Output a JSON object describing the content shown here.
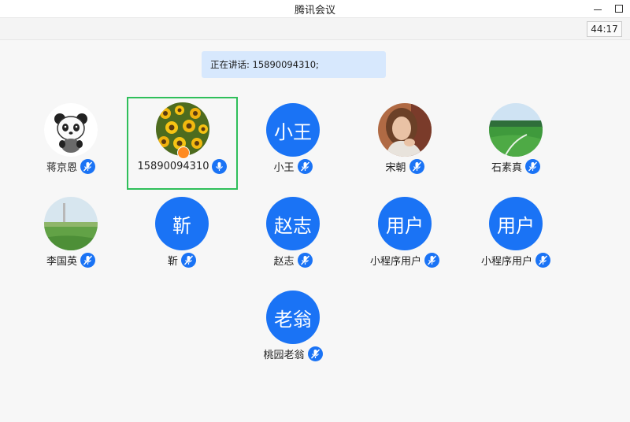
{
  "window": {
    "title": "腾讯会议"
  },
  "toolbar": {
    "timer": "44:17"
  },
  "speaking": {
    "text": "正在讲话: 15890094310;"
  },
  "participants": [
    {
      "name": "蒋京恩",
      "avatar": "panda-photo",
      "muted": true
    },
    {
      "name": "15890094310",
      "avatar": "sunflower-photo",
      "muted": false,
      "active": true,
      "host": true
    },
    {
      "name": "小王",
      "avatar_text": "小王",
      "muted": true
    },
    {
      "name": "宋朝",
      "avatar": "woman-photo",
      "muted": true
    },
    {
      "name": "石素真",
      "avatar": "grassland-photo",
      "muted": true
    },
    {
      "name": "李国英",
      "avatar": "landscape-photo",
      "muted": true
    },
    {
      "name": "靳",
      "avatar_text": "靳",
      "muted": true
    },
    {
      "name": "赵志",
      "avatar_text": "赵志",
      "muted": true
    },
    {
      "name": "小程序用户",
      "avatar_text": "用户",
      "muted": true
    },
    {
      "name": "小程序用户",
      "avatar_text": "用户",
      "muted": true
    },
    {
      "name": "桃园老翁",
      "avatar_text": "老翁",
      "muted": true
    }
  ],
  "colors": {
    "accent": "#1a73f5",
    "active_border": "#2fbf5a",
    "banner": "#d7e8fd",
    "host_badge": "#ff8a22"
  }
}
